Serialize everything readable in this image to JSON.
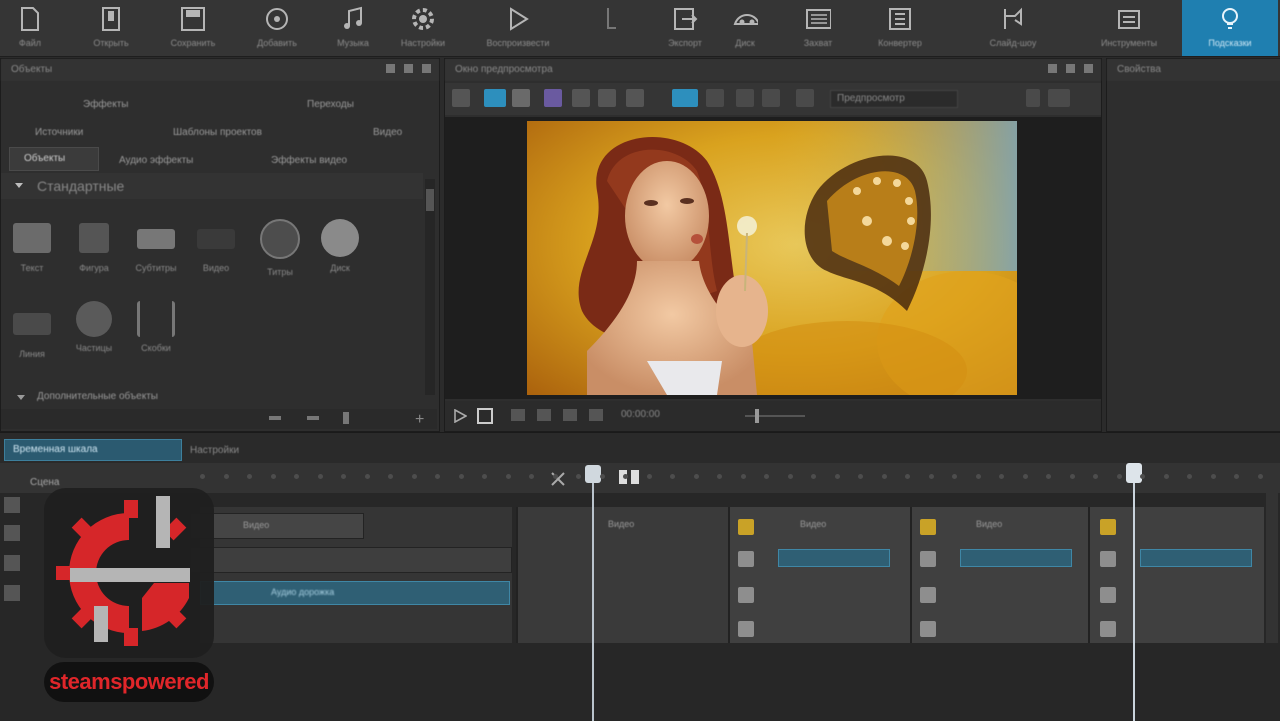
{
  "toolbar": {
    "items": [
      {
        "label": "Файл",
        "icon": "file-icon"
      },
      {
        "label": "Открыть",
        "icon": "open-icon"
      },
      {
        "label": "Сохранить",
        "icon": "save-icon"
      },
      {
        "label": "Добавить",
        "icon": "add-media-icon"
      },
      {
        "label": "Музыка",
        "icon": "music-icon"
      },
      {
        "label": "Настройки",
        "icon": "gear-icon"
      },
      {
        "label": "Воспроизвести",
        "icon": "play-icon"
      },
      {
        "label": "",
        "icon": "pin-icon"
      },
      {
        "label": "Экспорт",
        "icon": "export-icon"
      },
      {
        "label": "Диск",
        "icon": "disc-icon"
      },
      {
        "label": "Захват",
        "icon": "capture-icon"
      },
      {
        "label": "Конвертер",
        "icon": "converter-icon"
      },
      {
        "label": "Слайд-шоу",
        "icon": "slideshow-icon"
      },
      {
        "label": "Инструменты",
        "icon": "tools-icon"
      },
      {
        "label": "Подсказки",
        "icon": "lightbulb-icon"
      }
    ],
    "accent": "#1f7fb0"
  },
  "left_panel": {
    "title": "Объекты",
    "tabs_row1": [
      "Эффекты",
      "Переходы"
    ],
    "tabs_row2": [
      "Источники",
      "Шаблоны проектов",
      "Видео"
    ],
    "tabs_row3": [
      "Объекты",
      "Аудио эффекты",
      "Эффекты видео"
    ],
    "section": "Стандартные",
    "objects": [
      "Текст",
      "Фигура",
      "Субтитры",
      "Видео",
      "Титры",
      "Диск",
      "Линия",
      "Частицы",
      "Скобки"
    ],
    "footer_section": "Дополнительные объекты"
  },
  "preview": {
    "title": "Окно предпросмотра",
    "mode_label": "Предпросмотр",
    "timecode": "00:00:00"
  },
  "right_panel": {
    "title": "Свойства"
  },
  "timeline": {
    "tabs": [
      "Временная шкала",
      "Настройки"
    ],
    "scene_label": "Сцена",
    "clip_labels": [
      "Видео",
      "Видео",
      "Видео",
      "Видео"
    ],
    "audio_label": "Аудио дорожка"
  },
  "watermark": {
    "text": "steamspowered",
    "color": "#e0262a"
  }
}
